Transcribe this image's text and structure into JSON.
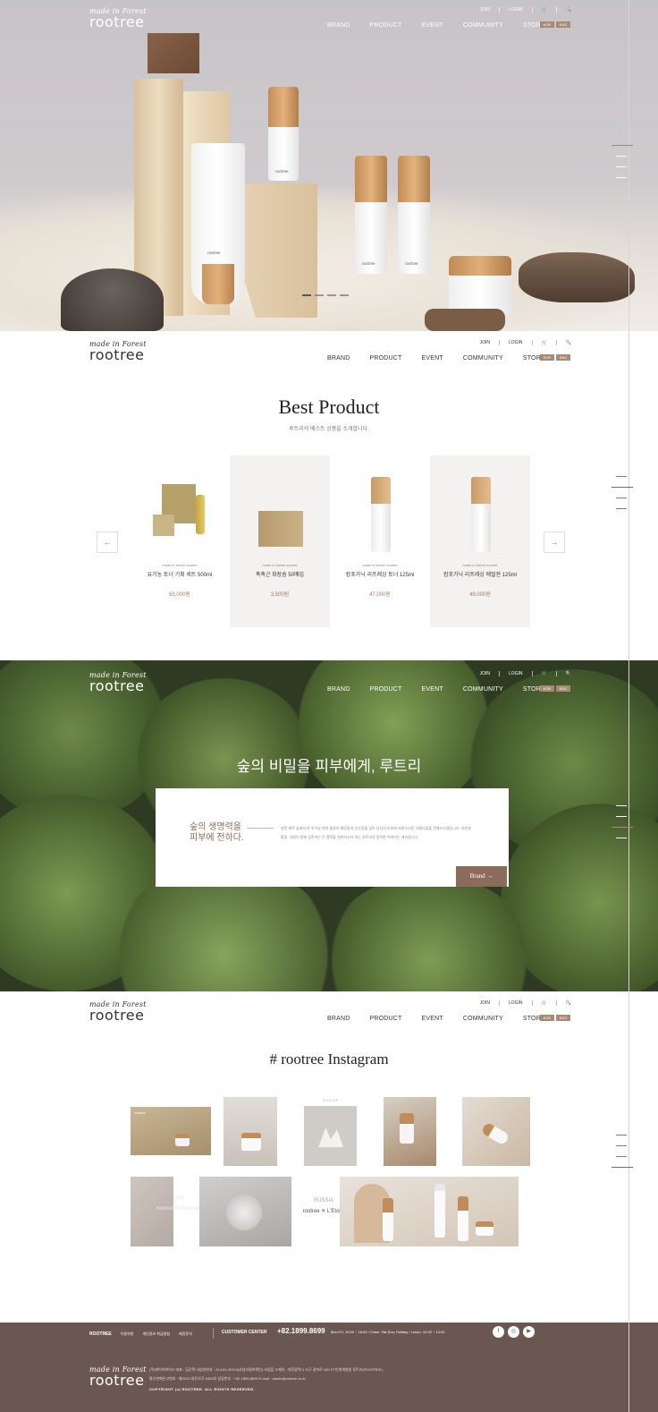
{
  "brand": {
    "tagline": "made in Forest",
    "name": "rootree"
  },
  "header": {
    "util": [
      "JOIN",
      "LOGIN",
      "🛒",
      "🔍"
    ],
    "nav": [
      "BRAND",
      "PRODUCT",
      "EVENT",
      "COMMUNITY",
      "STORE"
    ],
    "lang": [
      "KOR",
      "ENG"
    ]
  },
  "hero": {
    "product_mark": "rootree"
  },
  "best": {
    "title": "Best Product",
    "subtitle": "루트리의 베스트 상품을 소개합니다.",
    "prev": "←",
    "next": "→",
    "products": [
      {
        "maker": "made in forest rootree",
        "name": "유기농 토너 기획 세트 500ml",
        "price": "63,000원"
      },
      {
        "maker": "made in forest rootree",
        "name": "촉촉근 화장솜 50매입",
        "price": "3,500원"
      },
      {
        "maker": "made in forest rootree",
        "name": "캄포가닉 리프레싱 토너 125ml",
        "price": "47,000원"
      },
      {
        "maker": "made in forest rootree",
        "name": "캄포가닉 리프레싱 에멀젼 125ml",
        "price": "49,000원"
      }
    ]
  },
  "forest": {
    "slogan": "숲의 비밀을 피부에게, 루트리",
    "heading_1": "숲의 생명력을",
    "heading_2": "피부에 전하다.",
    "body": "청정 제주 숲에서 온 유기농 천연 원료의 깨끗함과 순수함을 담아 당신의 피부에 자연스러운 아름다움을 전해드리겠습니다. 자연과 환경, 사람이 함께 공존하는 큰 철학을 실현하고자 하는 루트리의 정직한 이야기는 계속됩니다.",
    "button": "Brand"
  },
  "instagram": {
    "title": "# rootree Instagram",
    "tile_1": "rootree",
    "tile_3": "SOOLIDE",
    "usa_1": "USA",
    "usa_2": "rootree ✕ Bespoke",
    "russia_1": "RUSSIA",
    "russia_2": "rootree ✕ L'Etoile"
  },
  "footer": {
    "links": [
      "ROOTREE",
      "이용약관",
      "개인정보 취급방침",
      "제휴문의"
    ],
    "cc_label": "CUSTOMER CENTER",
    "tel": "+82.1899.8699",
    "hours": "Mon-Fri, 10:00 ~ 18:00 / Close. Sat-Sun, Holiday / Lunch. 12:00 ~ 13:00",
    "sns": [
      "f",
      "◎",
      "▶"
    ],
    "info_1": "(주)에이피에이스 대표 : 당군택    사업자번호 : 314-81-42113(사업자정보확인)    사업장 소재지 : 대전광역시 서구 갈마로 160 KT인재개발원 루트리(ROOTREE)",
    "info_2": "통신판매신고번호 : 제2013-대전서구-0493호    상담번호 : +82-1899-8699    E-mail : admin@rootree.co.kr",
    "copy": "COPYRIGHT (c) ROOTREE. ALL RIGHTS RESERVED."
  },
  "colors": {
    "accent": "#a78a75",
    "footer": "#6b5751",
    "price": "#a07a60"
  }
}
